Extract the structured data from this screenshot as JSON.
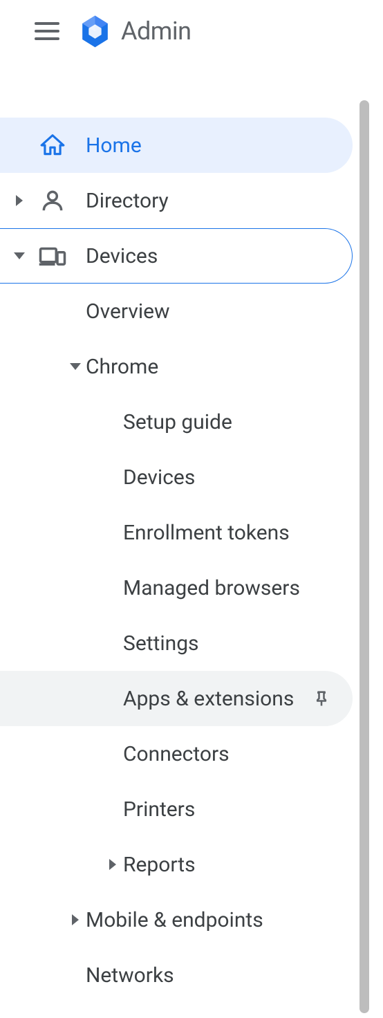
{
  "header": {
    "app_title": "Admin"
  },
  "nav": {
    "home": "Home",
    "directory": "Directory",
    "devices": {
      "label": "Devices",
      "overview": "Overview",
      "chrome": {
        "label": "Chrome",
        "setup_guide": "Setup guide",
        "devices": "Devices",
        "enrollment_tokens": "Enrollment tokens",
        "managed_browsers": "Managed browsers",
        "settings": "Settings",
        "apps_extensions": "Apps & extensions",
        "connectors": "Connectors",
        "printers": "Printers",
        "reports": "Reports"
      },
      "mobile_endpoints": "Mobile & endpoints",
      "networks": "Networks"
    }
  }
}
